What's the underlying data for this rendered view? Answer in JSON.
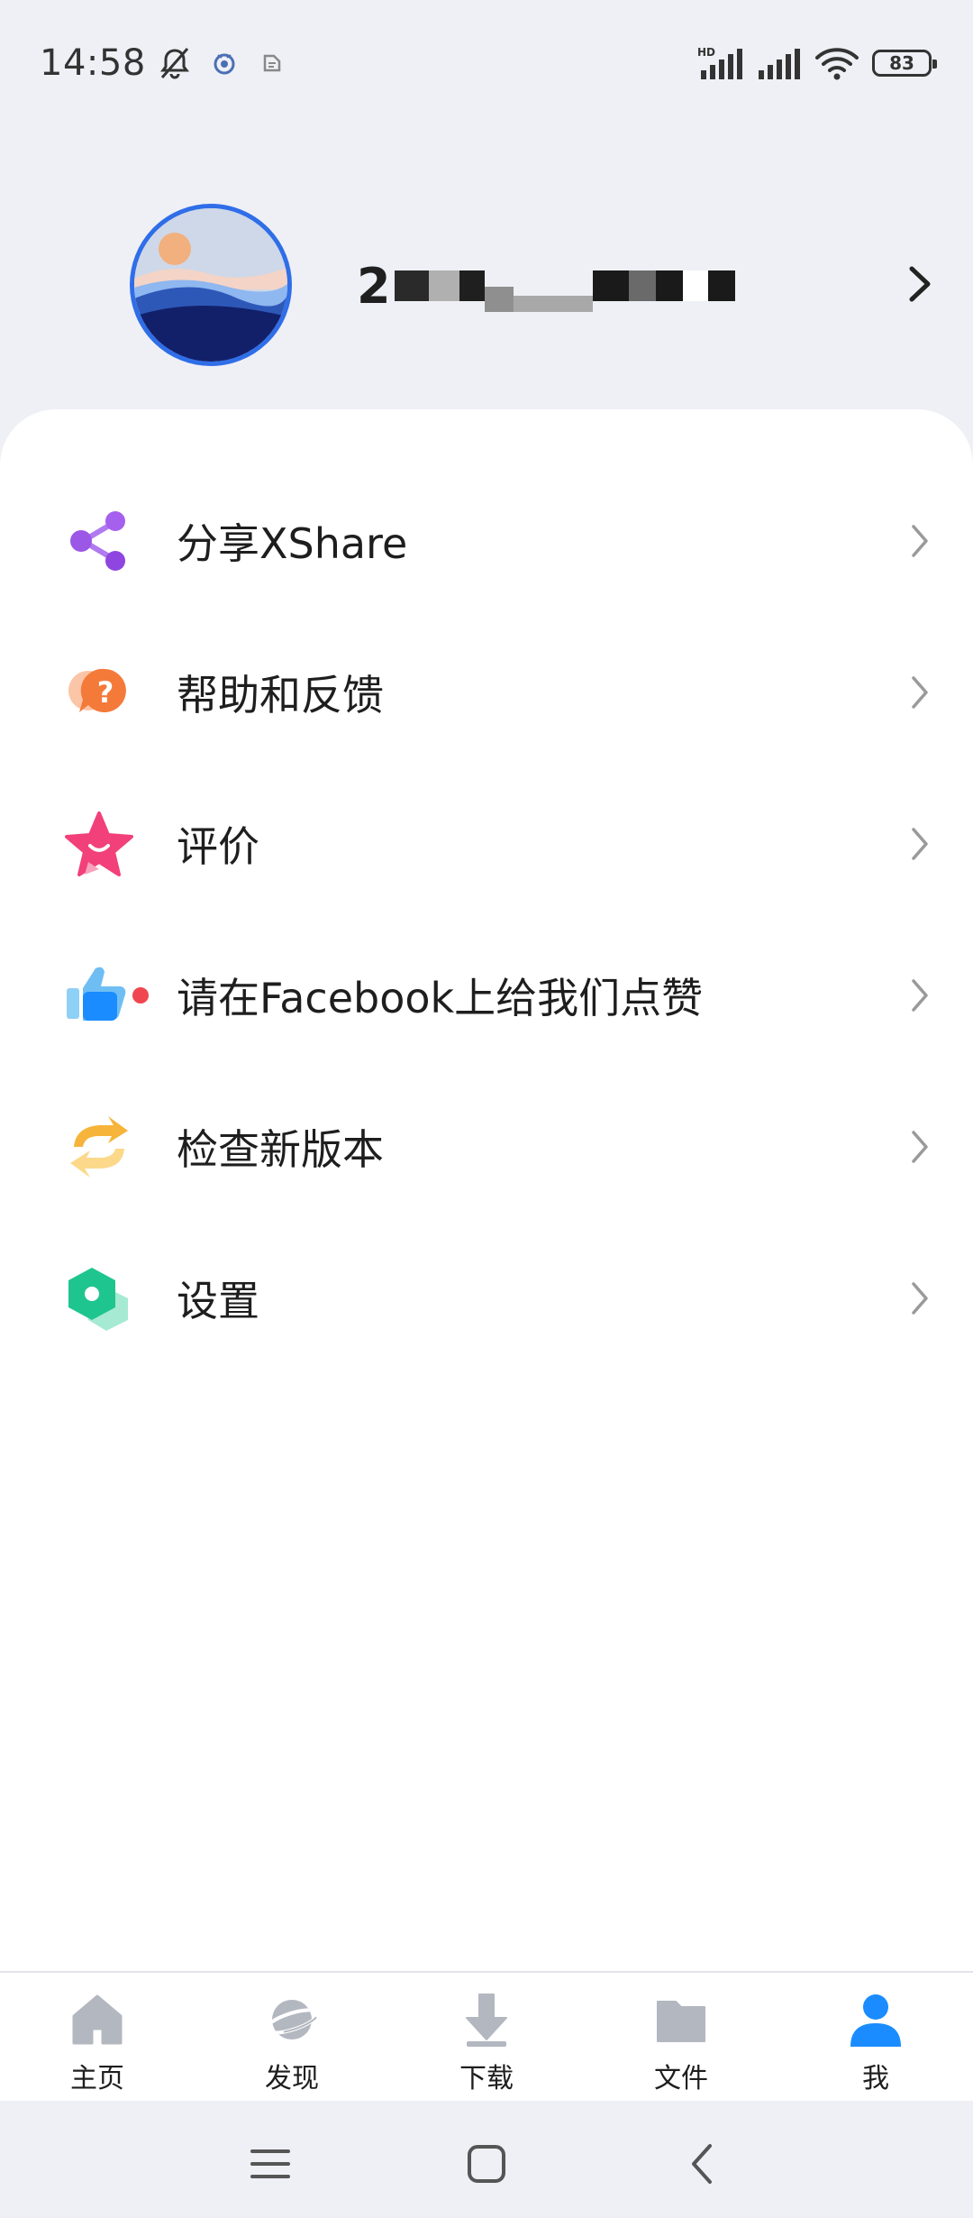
{
  "status_bar": {
    "time": "14:58",
    "battery": "83",
    "network_label": "HD",
    "icons": [
      "bell-off-icon",
      "app-notification-icon",
      "app-notification-icon",
      "signal-icon",
      "signal-icon",
      "wifi-icon",
      "battery-icon"
    ]
  },
  "profile": {
    "username_visible": "2",
    "username_redacted": true
  },
  "menu": [
    {
      "label": "分享XShare",
      "icon": "share-icon"
    },
    {
      "label": "帮助和反馈",
      "icon": "help-chat-icon"
    },
    {
      "label": "评价",
      "icon": "star-icon"
    },
    {
      "label": "请在Facebook上给我们点赞",
      "icon": "thumbs-up-icon",
      "has_dot": true
    },
    {
      "label": "检查新版本",
      "icon": "update-icon"
    },
    {
      "label": "设置",
      "icon": "settings-hex-icon"
    }
  ],
  "bottom_nav": {
    "items": [
      {
        "label": "主页",
        "icon": "home-icon",
        "active": false
      },
      {
        "label": "发现",
        "icon": "planet-icon",
        "active": false
      },
      {
        "label": "下载",
        "icon": "download-icon",
        "active": false
      },
      {
        "label": "文件",
        "icon": "folder-icon",
        "active": false
      },
      {
        "label": "我",
        "icon": "person-icon",
        "active": true
      }
    ]
  },
  "system_nav": [
    "menu-icon",
    "home-square-icon",
    "back-icon"
  ],
  "colors": {
    "accent": "#1a8cff",
    "inactive_icon": "#b3b7c0",
    "background": "#eff0f5",
    "chevron": "#9a9a9a"
  }
}
